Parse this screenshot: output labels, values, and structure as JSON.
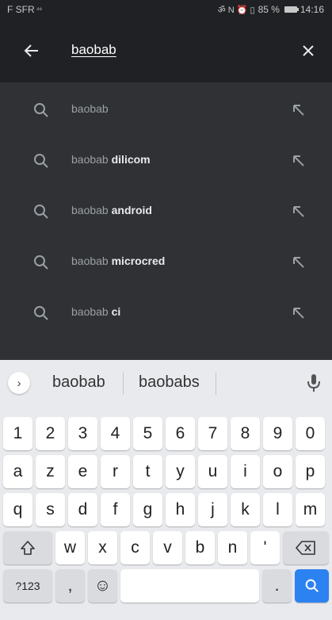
{
  "status_bar": {
    "carrier": "F SFR",
    "signal": "⁴⁶",
    "notif_icons": "ॐ N ⏰ ▯",
    "battery_pct": "85 %",
    "time": "14:16"
  },
  "search": {
    "query": "baobab",
    "back_icon": "arrow-left",
    "clear_icon": "close"
  },
  "suggestions": [
    {
      "prefix": "baobab",
      "suffix": ""
    },
    {
      "prefix": "baobab",
      "suffix": "dilicom"
    },
    {
      "prefix": "baobab",
      "suffix": "android"
    },
    {
      "prefix": "baobab",
      "suffix": "microcred"
    },
    {
      "prefix": "baobab",
      "suffix": "ci"
    }
  ],
  "keyboard": {
    "word_suggestions": [
      "baobab",
      "baobabs"
    ],
    "row_numbers": [
      "1",
      "2",
      "3",
      "4",
      "5",
      "6",
      "7",
      "8",
      "9",
      "0"
    ],
    "row1": [
      "a",
      "z",
      "e",
      "r",
      "t",
      "y",
      "u",
      "i",
      "o",
      "p"
    ],
    "row2": [
      "q",
      "s",
      "d",
      "f",
      "g",
      "h",
      "j",
      "k",
      "l",
      "m"
    ],
    "row3": [
      "w",
      "x",
      "c",
      "v",
      "b",
      "n",
      "'"
    ],
    "symbols_key": "?123",
    "comma_key": ",",
    "period_key": ".",
    "emoji_key": "☺"
  },
  "colors": {
    "header_bg": "#202124",
    "suggestions_bg": "#303134",
    "keyboard_bg": "#e9eaee",
    "search_key": "#2d82f2"
  }
}
